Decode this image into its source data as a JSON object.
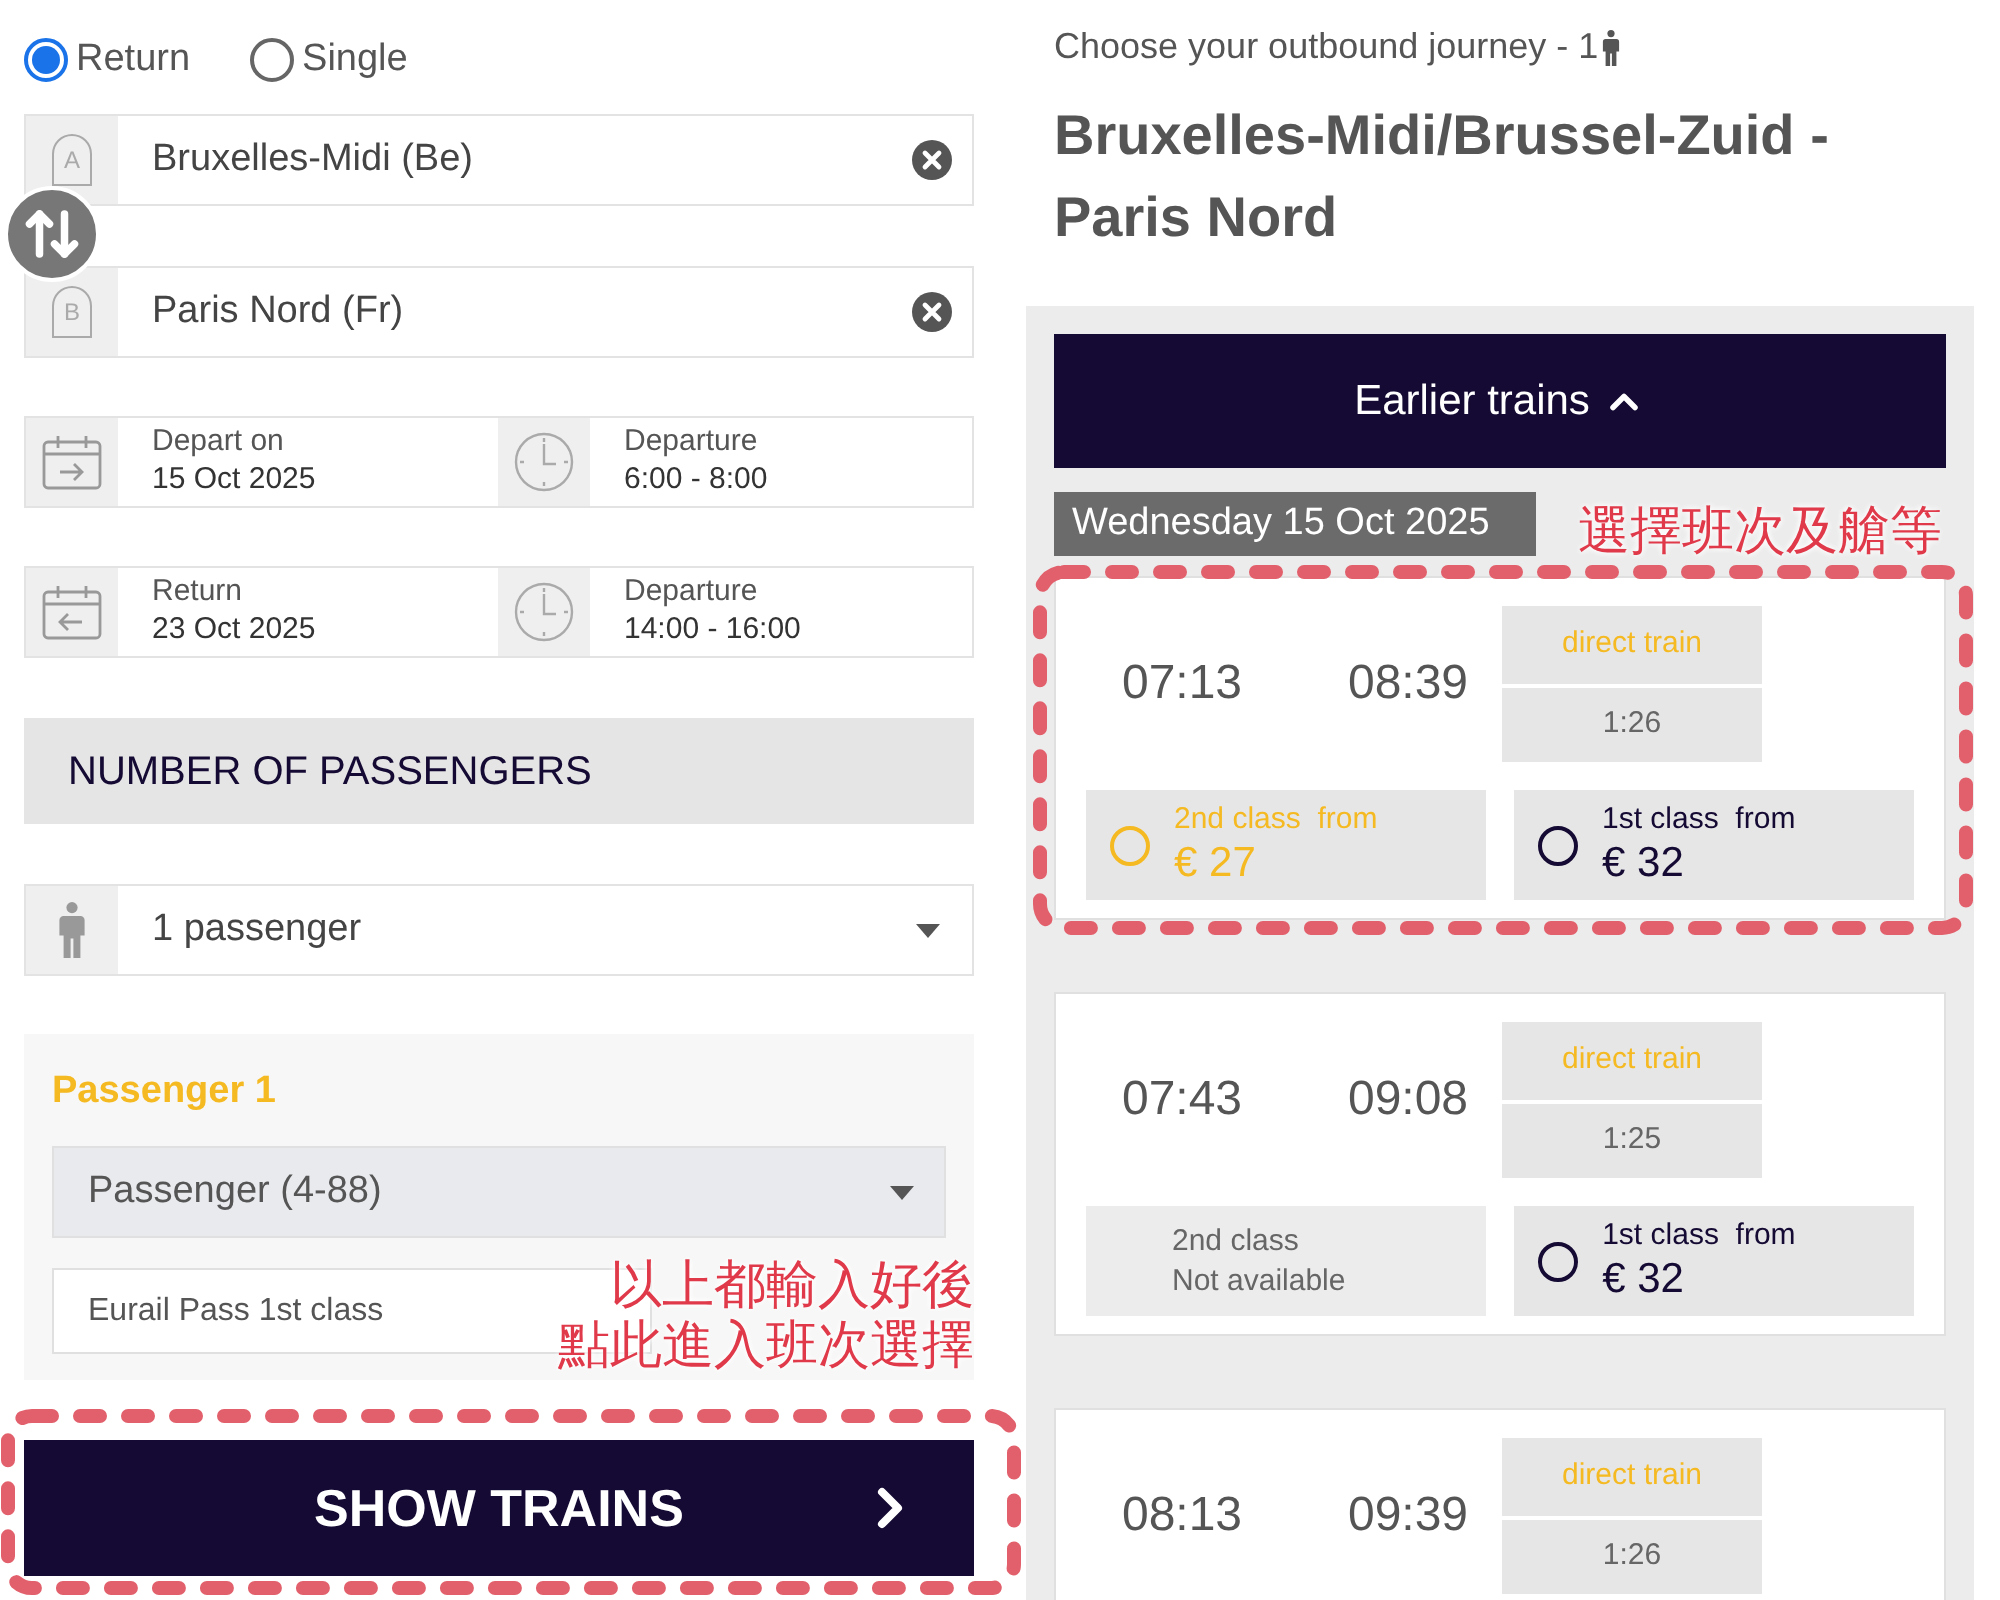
{
  "trip_type": [
    {
      "label": "Return",
      "selected": true
    },
    {
      "label": "Single",
      "selected": false
    }
  ],
  "stations": [
    {
      "marker": "A",
      "value": "Bruxelles-Midi (Be)"
    },
    {
      "marker": "B",
      "value": "Paris Nord (Fr)"
    }
  ],
  "dates": [
    {
      "kind": "outbound",
      "label": "Depart on",
      "date": "15 Oct 2025",
      "time_label": "Departure",
      "time": "6:00 - 8:00"
    },
    {
      "kind": "return",
      "label": "Return",
      "date": "23 Oct 2025",
      "time_label": "Departure",
      "time": "14:00 - 16:00"
    }
  ],
  "passengers": {
    "heading": "NUMBER OF PASSENGERS",
    "count": "1 passenger",
    "passenger_title": "Passenger 1",
    "type": "Passenger (4-88)",
    "pass": "Eurail Pass 1st class"
  },
  "show_trains": {
    "label": "SHOW TRAINS",
    "framed": true,
    "note": [
      "以上都輸入好後",
      "點此進入班次選擇"
    ]
  },
  "journey": {
    "subtitle": "Choose your outbound journey - 1",
    "title": "Bruxelles-Midi/Brussel-Zuid - Paris Nord",
    "earlier": "Earlier trains",
    "date": "Wednesday 15 Oct 2025",
    "date_note": "選擇班次及艙等"
  },
  "trains": [
    {
      "depart": "07:13",
      "arrive": "08:39",
      "route": "direct train",
      "duration": "1:26",
      "framed": true,
      "fares": [
        {
          "kind": "price",
          "class": "2nd class  from",
          "price": "€ 27",
          "highlighted": true,
          "selected": false
        },
        {
          "kind": "price",
          "class": "1st class  from",
          "price": "€ 32",
          "highlighted": false,
          "selected": false
        }
      ]
    },
    {
      "depart": "07:43",
      "arrive": "09:08",
      "route": "direct train",
      "duration": "1:25",
      "framed": false,
      "fares": [
        {
          "kind": "unavailable",
          "class": "2nd class",
          "status": "Not available"
        },
        {
          "kind": "price",
          "class": "1st class  from",
          "price": "€ 32",
          "highlighted": false,
          "selected": false
        }
      ]
    },
    {
      "depart": "08:13",
      "arrive": "09:39",
      "route": "direct train",
      "duration": "1:26",
      "framed": false
    }
  ]
}
